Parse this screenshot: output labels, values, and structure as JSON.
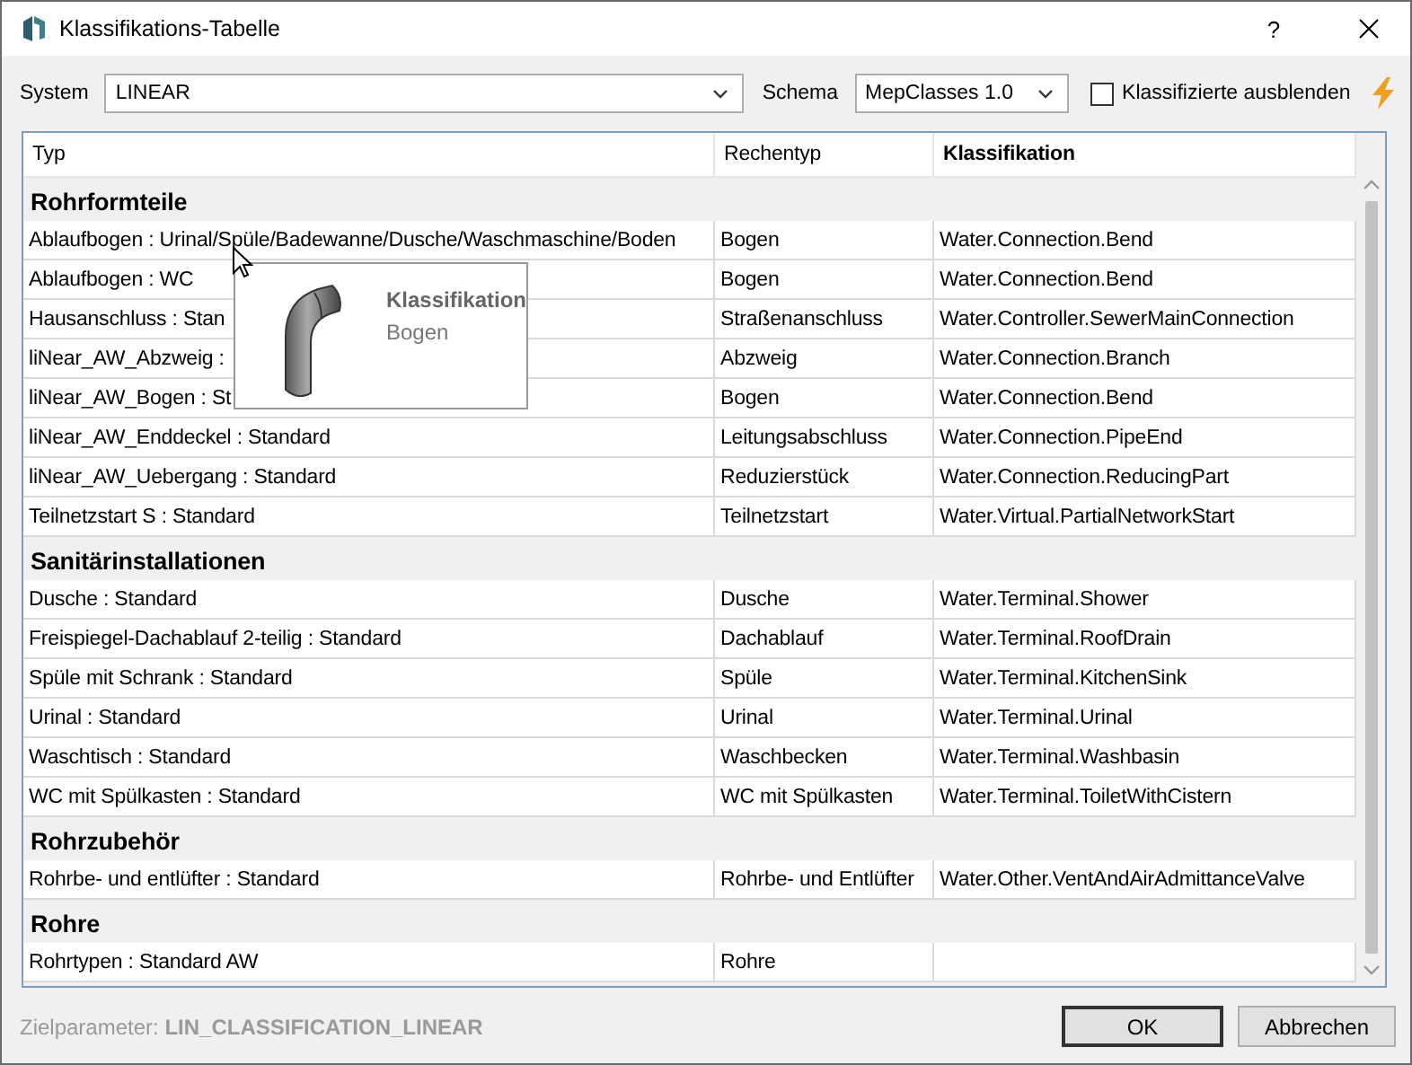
{
  "window": {
    "title": "Klassifikations-Tabelle",
    "help": "?"
  },
  "filters": {
    "system": {
      "label": "System",
      "value": "LINEAR"
    },
    "schema": {
      "label": "Schema",
      "value": "MepClasses 1.0"
    },
    "hide_classified": {
      "label": "Klassifizierte ausblenden",
      "checked": false
    }
  },
  "table": {
    "columns": [
      "Typ",
      "Rechentyp",
      "Klassifikation"
    ],
    "groups": [
      {
        "title": "Rohrformteile",
        "rows": [
          {
            "typ": "Ablaufbogen : Urinal/Spüle/Badewanne/Dusche/Waschmaschine/Boden",
            "rechentyp": "Bogen",
            "klassifikation": "Water.Connection.Bend"
          },
          {
            "typ": "Ablaufbogen : WC",
            "rechentyp": "Bogen",
            "klassifikation": "Water.Connection.Bend"
          },
          {
            "typ": "Hausanschluss : Stan",
            "rechentyp": "Straßenanschluss",
            "klassifikation": "Water.Controller.SewerMainConnection"
          },
          {
            "typ": "liNear_AW_Abzweig :",
            "rechentyp": "Abzweig",
            "klassifikation": "Water.Connection.Branch"
          },
          {
            "typ": "liNear_AW_Bogen : St",
            "rechentyp": "Bogen",
            "klassifikation": "Water.Connection.Bend"
          },
          {
            "typ": "liNear_AW_Enddeckel : Standard",
            "rechentyp": "Leitungsabschluss",
            "klassifikation": "Water.Connection.PipeEnd"
          },
          {
            "typ": "liNear_AW_Uebergang : Standard",
            "rechentyp": "Reduzierstück",
            "klassifikation": "Water.Connection.ReducingPart"
          },
          {
            "typ": "Teilnetzstart S : Standard",
            "rechentyp": "Teilnetzstart",
            "klassifikation": "Water.Virtual.PartialNetworkStart"
          }
        ]
      },
      {
        "title": "Sanitärinstallationen",
        "rows": [
          {
            "typ": "Dusche : Standard",
            "rechentyp": "Dusche",
            "klassifikation": "Water.Terminal.Shower"
          },
          {
            "typ": "Freispiegel-Dachablauf 2-teilig : Standard",
            "rechentyp": "Dachablauf",
            "klassifikation": "Water.Terminal.RoofDrain"
          },
          {
            "typ": "Spüle mit Schrank : Standard",
            "rechentyp": "Spüle",
            "klassifikation": "Water.Terminal.KitchenSink"
          },
          {
            "typ": "Urinal : Standard",
            "rechentyp": "Urinal",
            "klassifikation": "Water.Terminal.Urinal"
          },
          {
            "typ": "Waschtisch : Standard",
            "rechentyp": "Waschbecken",
            "klassifikation": "Water.Terminal.Washbasin"
          },
          {
            "typ": "WC mit Spülkasten : Standard",
            "rechentyp": "WC mit Spülkasten",
            "klassifikation": "Water.Terminal.ToiletWithCistern"
          }
        ]
      },
      {
        "title": "Rohrzubehör",
        "rows": [
          {
            "typ": "Rohrbe- und entlüfter : Standard",
            "rechentyp": "Rohrbe- und Entlüfter",
            "klassifikation": "Water.Other.VentAndAirAdmittanceValve"
          }
        ]
      },
      {
        "title": "Rohre",
        "rows": [
          {
            "typ": "Rohrtypen : Standard AW",
            "rechentyp": "Rohre"
          }
        ]
      }
    ]
  },
  "tooltip": {
    "title": "Klassifikation",
    "text": "Bogen"
  },
  "footer": {
    "label": "Zielparameter:",
    "value": "LIN_CLASSIFICATION_LINEAR"
  },
  "buttons": [
    {
      "label": "OK",
      "default": true
    },
    {
      "label": "Abbrechen",
      "default": false
    }
  ]
}
